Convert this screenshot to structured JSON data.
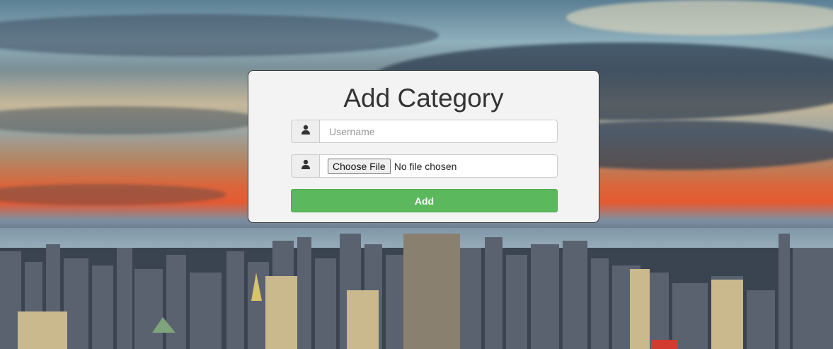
{
  "form": {
    "title": "Add Category",
    "username_placeholder": "Username",
    "choose_file_label": "Choose File",
    "file_status": "No file chosen",
    "add_label": "Add"
  },
  "icons": {
    "username_addon": "user-icon",
    "file_addon": "user-icon"
  },
  "colors": {
    "add_button": "#5cb85c",
    "panel_background": "#f3f3f3"
  }
}
